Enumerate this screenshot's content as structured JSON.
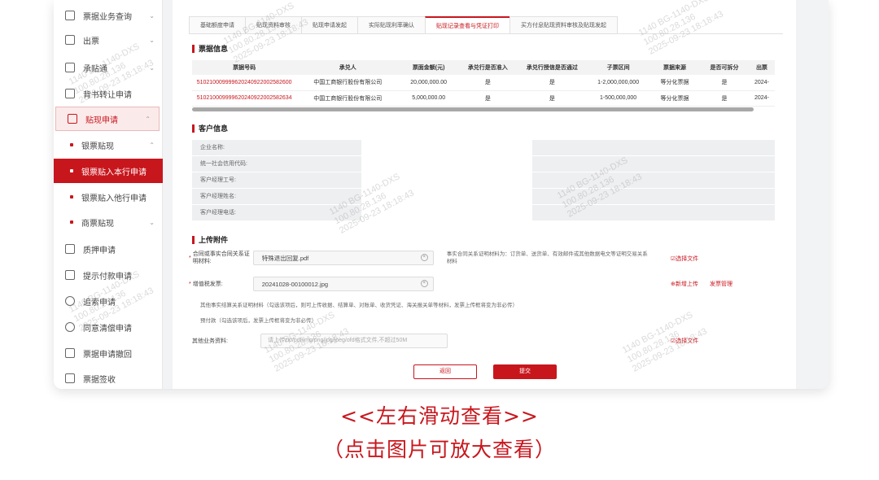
{
  "sidebar": {
    "items": [
      {
        "label": "票据业务查询"
      },
      {
        "label": "出票"
      },
      {
        "label": "承贴通"
      },
      {
        "label": "背书转让申请"
      },
      {
        "label": "贴现申请"
      },
      {
        "label": "质押申请"
      },
      {
        "label": "提示付款申请"
      },
      {
        "label": "追索申请"
      },
      {
        "label": "同意清偿申请"
      },
      {
        "label": "票据申请撤回"
      },
      {
        "label": "票据签收"
      }
    ],
    "sub_items": [
      {
        "label": "银票贴现"
      },
      {
        "label": "银票贴入本行申请"
      },
      {
        "label": "银票贴入他行申请"
      },
      {
        "label": "商票贴现"
      }
    ]
  },
  "tabs": [
    "基础额度申请",
    "贴现资料审核",
    "贴现申请发起",
    "实际贴现利率确认",
    "贴现记录查看与凭证打印",
    "买方付息贴现资料审核及贴现发起"
  ],
  "bill_info": {
    "title": "票据信息",
    "headers": [
      "票据号码",
      "承兑人",
      "票面金额(元)",
      "承兑行是否准入",
      "承兑行授信是否通过",
      "子票区间",
      "票据来源",
      "是否可拆分",
      "出票"
    ],
    "rows": [
      [
        "510210009999620240922002582600",
        "中国工商银行股份有限公司",
        "20,000,000.00",
        "是",
        "是",
        "1-2,000,000,000",
        "等分化票据",
        "是",
        "2024-"
      ],
      [
        "510210009999620240922002582634",
        "中国工商银行股份有限公司",
        "5,000,000.00",
        "是",
        "是",
        "1-500,000,000",
        "等分化票据",
        "是",
        "2024-"
      ]
    ]
  },
  "customer_info": {
    "title": "客户信息",
    "fields": [
      "企业名称:",
      "统一社会信用代码:",
      "客户经理工号:",
      "客户经理姓名:",
      "客户经理电话:"
    ]
  },
  "attachments": {
    "title": "上传附件",
    "contract_label": "合同或事实合同关系证明材料:",
    "contract_file": "特殊退出回复.pdf",
    "contract_hint": "事实合同关系证明材料为：订货单、送货单、有效邮件或其他数据电文等证明交易关系材料",
    "select_file": "选择文件",
    "vat_label": "增值税发票:",
    "vat_file": "20241028-00100012.jpg",
    "add_upload": "新增上传",
    "invoice_manage": "发票管理",
    "other_hint": "其他事实结算关系证明材料（勾选该项后，则可上传收据、结算单、对账单、收货凭证、海关报关单等材料，发票上传框将变为非必传）",
    "prepay_hint": "预付款（勾选该项后，发票上传框将变为非必传）",
    "other_label": "其他业务资料:",
    "other_placeholder": "请上传zip/pdf/img/png/jpg/jpeg/ofd格式文件,不超过50M",
    "select_file2": "选择文件"
  },
  "buttons": {
    "return": "返回",
    "submit": "提交"
  },
  "watermark": {
    "id": "1140 BG-1140-DXS",
    "ip": "100.80.28.136",
    "time": "2025-09-23 18:18:43"
  },
  "captions": {
    "line1": "<<左右滑动查看>>",
    "line2": "（点击图片可放大查看）"
  },
  "colors": {
    "accent": "#c8161d"
  }
}
